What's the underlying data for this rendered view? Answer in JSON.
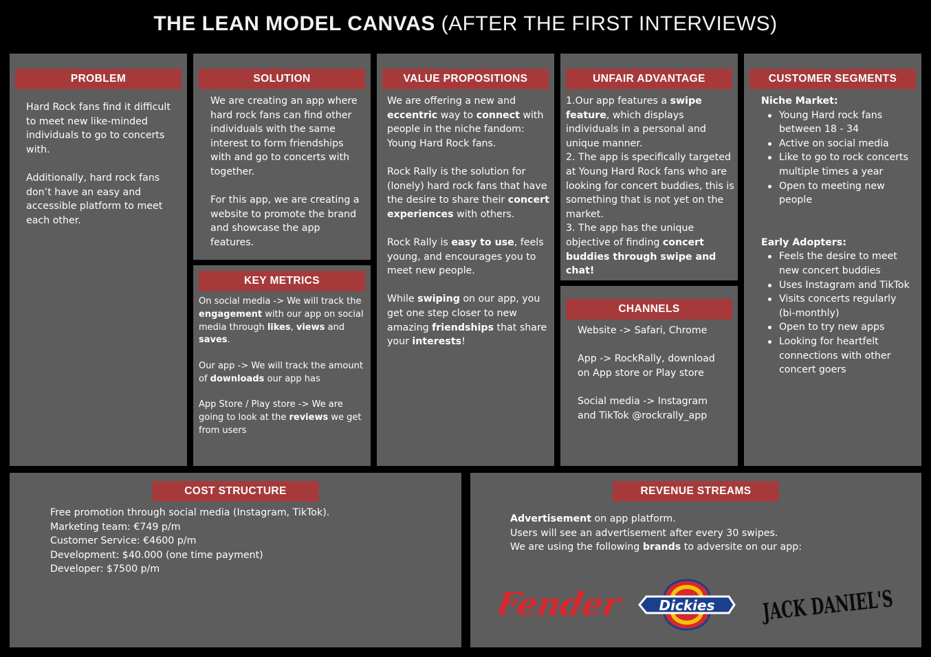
{
  "title": {
    "main": "THE LEAN MODEL CANVAS ",
    "paren": "(AFTER THE FIRST INTERVIEWS)"
  },
  "problem": {
    "header": "PROBLEM",
    "p1": "Hard Rock fans find it difficult to meet new like-minded individuals to go to concerts with.",
    "p2": "Additionally, hard rock fans don’t have an easy and accessible platform to meet each other."
  },
  "solution": {
    "header": "SOLUTION",
    "p1": "We are creating an app where hard rock fans can find other individuals with the same interest to form friendships with and go to concerts with together.",
    "p2": "For this app, we are creating a website to promote the brand and showcase the app features."
  },
  "key_metrics": {
    "header": "KEY METRICS",
    "p1a": "On social media -> We will track the ",
    "p1b": "engagement",
    "p1c": " with our app on social media through ",
    "p1d": "likes",
    "p1e": ", ",
    "p1f": "views",
    "p1g": " and ",
    "p1h": "saves",
    "p1i": ".",
    "p2a": "Our app -> We will track the amount of ",
    "p2b": "downloads",
    "p2c": " our app has",
    "p3a": "App Store / Play store -> We are going to look at the ",
    "p3b": "reviews",
    "p3c": " we get from users"
  },
  "value_propositions": {
    "header": "VALUE PROPOSITIONS",
    "p1a": "We are offering a new and ",
    "p1b": "eccentric",
    "p1c": " way to ",
    "p1d": "connect",
    "p1e": " with people in the niche fandom: Young Hard Rock fans.",
    "p2a": "Rock Rally is the solution for (lonely) hard rock fans that have the desire to share their ",
    "p2b": "concert experiences",
    "p2c": " with others.",
    "p3a": "Rock Rally is ",
    "p3b": "easy to use",
    "p3c": ", feels young, and encourages you to meet new people.",
    "p4a": "While ",
    "p4b": "swiping",
    "p4c": " on our app, you get one step closer to new amazing ",
    "p4d": "friendships",
    "p4e": " that share your ",
    "p4f": "interests",
    "p4g": "!"
  },
  "unfair_advantage": {
    "header": "UNFAIR ADVANTAGE",
    "p1a": "1.Our app features a ",
    "p1b": "swipe feature",
    "p1c": ", which displays individuals in a personal and unique manner.",
    "p2": "2. The app is specifically targeted at Young Hard Rock fans who are looking for concert buddies, this is something that is not yet on the market.",
    "p3a": "3. The app has the unique objective of finding ",
    "p3b": "concert buddies through swipe and chat!"
  },
  "channels": {
    "header": "CHANNELS",
    "p1": "Website -> Safari, Chrome",
    "p2": "App -> RockRally, download on App store or Play store",
    "p3": "Social media -> Instagram and TikTok @rockrally_app"
  },
  "customer_segments": {
    "header": "CUSTOMER SEGMENTS",
    "niche_title": "Niche Market:",
    "niche": [
      "Young Hard rock fans between 18 - 34",
      "Active on social media",
      "Like to go to rock concerts multiple times a year",
      "Open to meeting new people"
    ],
    "early_title": "Early Adopters:",
    "early": [
      "Feels the desire to meet new concert buddies",
      "Uses Instagram and TikTok",
      "Visits concerts regularly (bi-monthly)",
      "Open to try new apps",
      "Looking for heartfelt connections with other concert goers"
    ]
  },
  "cost_structure": {
    "header": "COST STRUCTURE",
    "lines": [
      "Free promotion through social media (Instagram, TikTok).",
      "Marketing team: €749 p/m",
      "Customer Service: €4600 p/m",
      "Development: $40.000 (one time payment)",
      "Developer: $7500 p/m"
    ]
  },
  "revenue_streams": {
    "header": "REVENUE STREAMS",
    "l1a": "Advertisement",
    "l1b": " on app platform.",
    "l2": "Users will see an advertisement after every 30 swipes.",
    "l3a": "We are using the following ",
    "l3b": "brands",
    "l3c": " to adversite on our app:",
    "brands": [
      "Fender",
      "Dickies",
      "JACK DANIEL'S"
    ]
  },
  "colors": {
    "background": "#000000",
    "panel": "#5d5d5d",
    "header": "#a63a3b",
    "fender": "#d8282e",
    "dickies_blue": "#1c3f8c",
    "dickies_yellow": "#f4c20d",
    "dickies_red": "#d42a2a"
  }
}
